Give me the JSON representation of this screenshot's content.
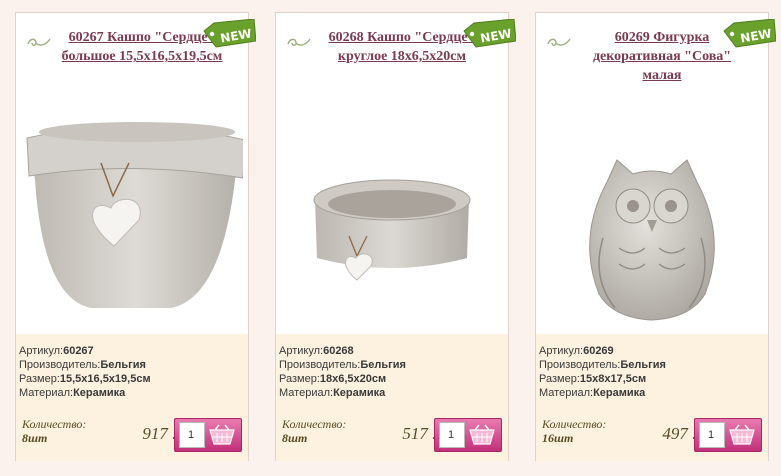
{
  "products": [
    {
      "title": "60267 Кашпо \"Сердце\" большое 15,5x16,5x19,5см",
      "badge": "NEW",
      "article_label": "Артикул:",
      "article": "60267",
      "maker_label": "Производитель:",
      "maker": "Бельгия",
      "size_label": "Размер:",
      "size": "15,5x16,5x19,5см",
      "material_label": "Материал:",
      "material": "Керамика",
      "qty_label": "Количество:",
      "stock": "8шт",
      "price": "917 .-",
      "qty_value": "1",
      "image": "heart-planter-large"
    },
    {
      "title": "60268 Кашпо \"Сердце\" круглое 18x6,5x20см",
      "badge": "NEW",
      "article_label": "Артикул:",
      "article": "60268",
      "maker_label": "Производитель:",
      "maker": "Бельгия",
      "size_label": "Размер:",
      "size": "18x6,5x20см",
      "material_label": "Материал:",
      "material": "Керамика",
      "qty_label": "Количество:",
      "stock": "8шт",
      "price": "517 .-",
      "qty_value": "1",
      "image": "heart-planter-round"
    },
    {
      "title": "60269 Фигурка декоративная \"Сова\" малая",
      "badge": "NEW",
      "article_label": "Артикул:",
      "article": "60269",
      "maker_label": "Производитель:",
      "maker": "Бельгия",
      "size_label": "Размер:",
      "size": "15x8x17,5см",
      "material_label": "Материал:",
      "material": "Керамика",
      "qty_label": "Количество:",
      "stock": "16шт",
      "price": "497 .-",
      "qty_value": "1",
      "image": "owl-figurine"
    }
  ],
  "colors": {
    "title": "#7a3a52",
    "badge_green": "#6aa02c",
    "cart_pink": "#d1448c",
    "info_bg": "#fdf1e0"
  }
}
